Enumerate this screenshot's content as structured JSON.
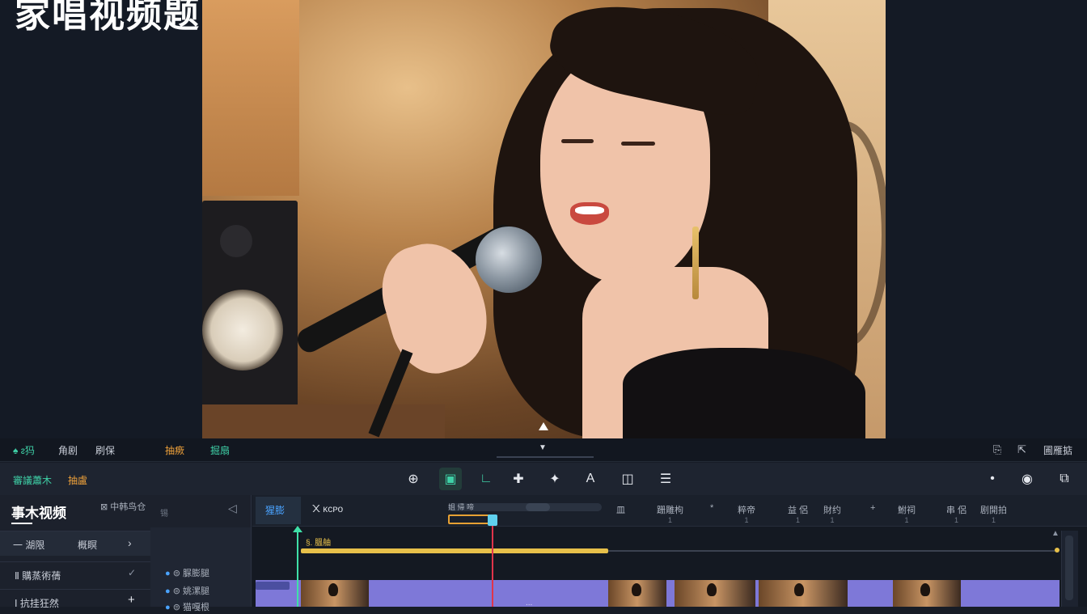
{
  "preview": {
    "overlay_title": "家唱视频题"
  },
  "top_bar": {
    "left_items": [
      {
        "label": "♠ ᴤ犸",
        "color": "#3fd1a7"
      },
      {
        "label": "角剧",
        "color": "#c9ced8"
      },
      {
        "label": "刷保",
        "color": "#c9ced8"
      },
      {
        "label": "抽瘚",
        "color": "#f0a23a"
      },
      {
        "label": "掘扇",
        "color": "#3fd1a7"
      }
    ],
    "right_label": "圃雁掂"
  },
  "toolbar": {
    "left_items": [
      {
        "label": "審議蕭木",
        "color": "#3fd1a7"
      },
      {
        "label": "抽盧",
        "color": "#f0a23a"
      }
    ],
    "tools": [
      {
        "icon": "add-circle-icon",
        "glyph": "⊕"
      },
      {
        "icon": "layout-icon",
        "glyph": "▣"
      },
      {
        "icon": "crop-corner-icon",
        "glyph": "∟"
      },
      {
        "icon": "pin-icon",
        "glyph": "✚"
      },
      {
        "icon": "magic-wand-icon",
        "glyph": "✦"
      },
      {
        "icon": "text-style-icon",
        "glyph": "A"
      },
      {
        "icon": "layers-icon",
        "glyph": "◫"
      },
      {
        "icon": "menu-icon",
        "glyph": "☰"
      }
    ],
    "right_tools": [
      {
        "icon": "dot-icon",
        "glyph": "•"
      },
      {
        "icon": "eye-icon",
        "glyph": "◉"
      },
      {
        "icon": "export-icon",
        "glyph": "⧉"
      }
    ]
  },
  "left_panel": {
    "title": "事木视频",
    "tab_b": "⊠ 中韩鸟仓",
    "tab_c": "锡",
    "rows": [
      {
        "label": "一  湖限",
        "sub": "概瞑"
      },
      {
        "label": "Ⅱ  購蒸術蒨"
      },
      {
        "label": "Ⅰ  抗挂狂然"
      }
    ],
    "sub_items": [
      "⊜ 脲膨腿",
      "⊜ 姚漯腿",
      "⊜ 猫嘎根"
    ]
  },
  "timeline": {
    "track_tab": "猩膨",
    "track_name": "᙭ ᴋᴄᴘᴏ",
    "scrubber_label": "姐 帰 啼",
    "ticks": [
      {
        "label": "皿",
        "sub": ""
      },
      {
        "label": "跚雕枸",
        "sub": "1"
      },
      {
        "label": "*",
        "sub": ""
      },
      {
        "label": "粹帝",
        "sub": "1"
      },
      {
        "label": "益 侶",
        "sub": "1"
      },
      {
        "label": "財约",
        "sub": "1"
      },
      {
        "label": "+",
        "sub": ""
      },
      {
        "label": "鮒祠",
        "sub": "1"
      },
      {
        "label": "串 侶",
        "sub": "1"
      },
      {
        "label": "剧開拍",
        "sub": "1"
      }
    ],
    "audio_clip_label": "§. 膃舳",
    "video_clip_label": "..."
  }
}
